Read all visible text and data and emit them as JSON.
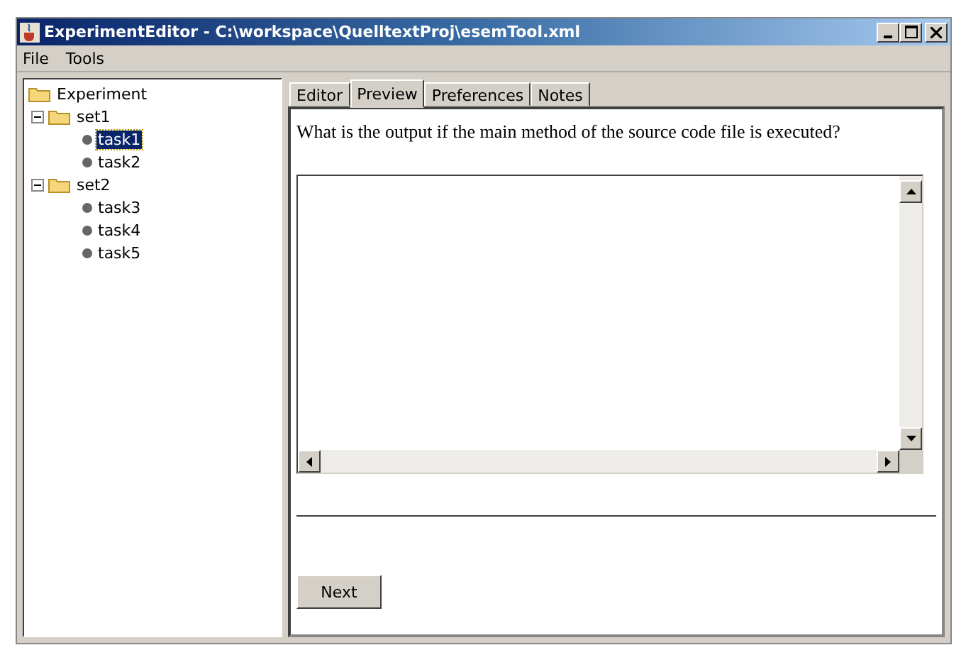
{
  "window": {
    "title": "ExperimentEditor - C:\\workspace\\QuelltextProj\\esemTool.xml"
  },
  "menu": [
    "File",
    "Tools"
  ],
  "tree": {
    "label": "Experiment",
    "children": [
      {
        "label": "set1",
        "expanded": true,
        "children": [
          {
            "label": "task1",
            "selected": true
          },
          {
            "label": "task2",
            "selected": false
          }
        ]
      },
      {
        "label": "set2",
        "expanded": true,
        "children": [
          {
            "label": "task3",
            "selected": false
          },
          {
            "label": "task4",
            "selected": false
          },
          {
            "label": "task5",
            "selected": false
          }
        ]
      }
    ]
  },
  "tabs": [
    {
      "label": "Editor",
      "selected": false
    },
    {
      "label": "Preview",
      "selected": true
    },
    {
      "label": "Preferences",
      "selected": false
    },
    {
      "label": "Notes",
      "selected": false
    }
  ],
  "question": "What is the output if the main method of the source code file is executed?",
  "buttons": [
    "Next"
  ]
}
